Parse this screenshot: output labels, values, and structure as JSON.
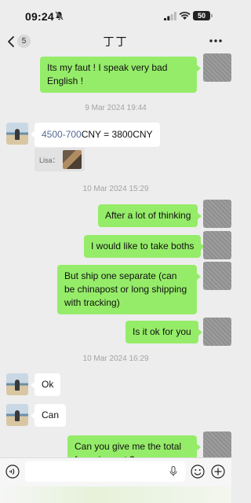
{
  "status_bar": {
    "time": "09:24",
    "battery": "50"
  },
  "header": {
    "unread_count": "5",
    "title": "丁丁"
  },
  "messages": {
    "m1": "Its my faut ! I speak very bad English !",
    "ts1": "9 Mar 2024 19:44",
    "m2_link": "4500-700",
    "m2_rest": "CNY = 3800CNY",
    "m2_quote_label": "Lisa：",
    "ts2": "10 Mar 2024 15:29",
    "m3": "After a lot of thinking",
    "m4": "I would like to take boths",
    "m5": "But ship one separate (can be chinapost or long shipping with tracking)",
    "m6": "Is it ok for you",
    "ts3": "10 Mar 2024 16:29",
    "m7": "Ok",
    "m8": "Can",
    "m9": "Can you give me the total for paiement ?"
  },
  "input": {
    "value": ""
  },
  "colors": {
    "outgoing_bubble": "#95ec69",
    "incoming_bubble": "#ffffff",
    "background": "#ededed",
    "link": "#576b95"
  }
}
